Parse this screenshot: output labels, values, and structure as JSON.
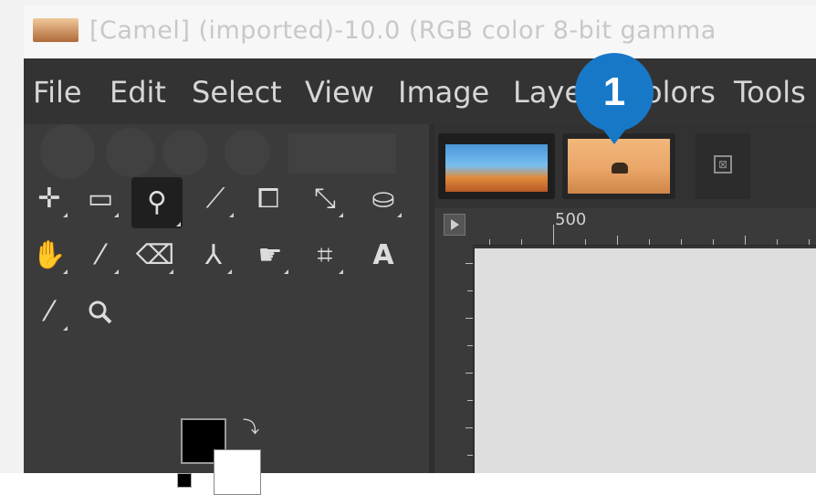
{
  "window": {
    "title": "[Camel] (imported)-10.0 (RGB color 8-bit gamma"
  },
  "menubar": {
    "items": [
      "File",
      "Edit",
      "Select",
      "View",
      "Image",
      "Laye",
      "olors",
      "Tools"
    ]
  },
  "toolbox": {
    "tools": [
      {
        "name": "move-tool-icon",
        "glyph": "✛"
      },
      {
        "name": "rect-select-tool-icon",
        "glyph": "▭"
      },
      {
        "name": "free-select-tool-icon",
        "glyph": "⚲"
      },
      {
        "name": "fuzzy-select-tool-icon",
        "glyph": "⟋"
      },
      {
        "name": "crop-tool-icon",
        "glyph": "⧠"
      },
      {
        "name": "transform-tool-icon",
        "glyph": "⤡"
      },
      {
        "name": "bucket-fill-tool-icon",
        "glyph": "⛀"
      },
      {
        "name": "paint-tool-icon",
        "glyph": "✋"
      },
      {
        "name": "paintbrush-tool-icon",
        "glyph": "⁄"
      },
      {
        "name": "eraser-tool-icon",
        "glyph": "⌫"
      },
      {
        "name": "clone-tool-icon",
        "glyph": "⅄"
      },
      {
        "name": "smudge-tool-icon",
        "glyph": "☛"
      },
      {
        "name": "paths-tool-icon",
        "glyph": "⌗"
      },
      {
        "name": "text-tool-icon",
        "glyph": "A"
      },
      {
        "name": "color-picker-tool-icon",
        "glyph": "⁄"
      },
      {
        "name": "zoom-tool-icon",
        "glyph": "🔍︎"
      }
    ],
    "foreground_color": "#000000",
    "background_color": "#ffffff"
  },
  "ruler": {
    "top_label": "500"
  },
  "callout": {
    "label": "1"
  }
}
